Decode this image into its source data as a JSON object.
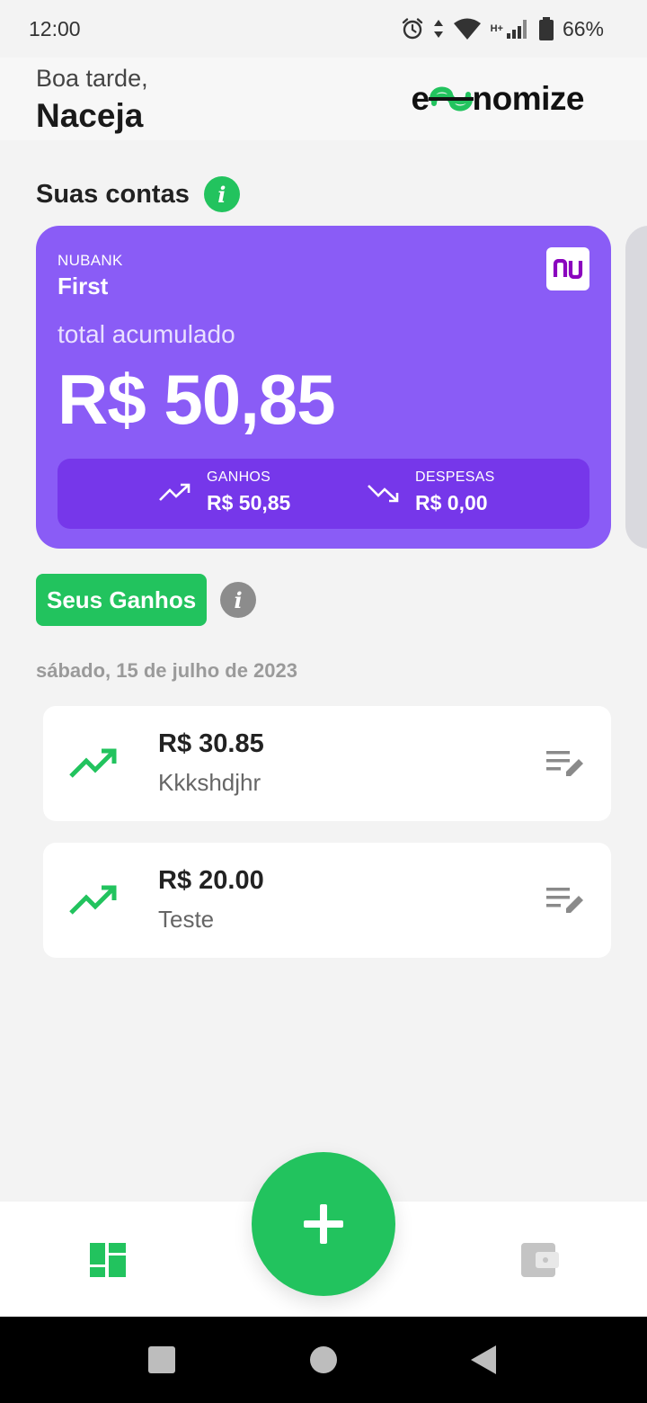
{
  "status_bar": {
    "time": "12:00",
    "network": "H+",
    "battery": "66%"
  },
  "header": {
    "greeting": "Boa tarde,",
    "user_name": "Naceja",
    "logo_prefix": "e",
    "logo_suffix": "nomize",
    "brand_color": "#22c35e"
  },
  "accounts": {
    "section_title": "Suas contas",
    "card": {
      "bank": "NUBANK",
      "name": "First",
      "bank_logo_text": "nu",
      "total_label": "total acumulado",
      "total_value": "R$ 50,85",
      "color": "#8a5cf6",
      "summary_color": "#7637ea",
      "gains_label": "GANHOS",
      "gains_value": "R$ 50,85",
      "expenses_label": "DESPESAS",
      "expenses_value": "R$ 0,00"
    }
  },
  "gains": {
    "title": "Seus Ganhos",
    "date": "sábado, 15 de julho de 2023",
    "transactions": [
      {
        "amount": "R$ 30.85",
        "description": "Kkkshdjhr",
        "icon": "trending-up-icon"
      },
      {
        "amount": "R$ 20.00",
        "description": "Teste",
        "icon": "trending-up-icon"
      }
    ]
  },
  "bottom_nav": {
    "items": [
      "dashboard-icon",
      "wallet-icon"
    ],
    "fab_icon": "plus-icon"
  },
  "info_icon_glyph": "i"
}
